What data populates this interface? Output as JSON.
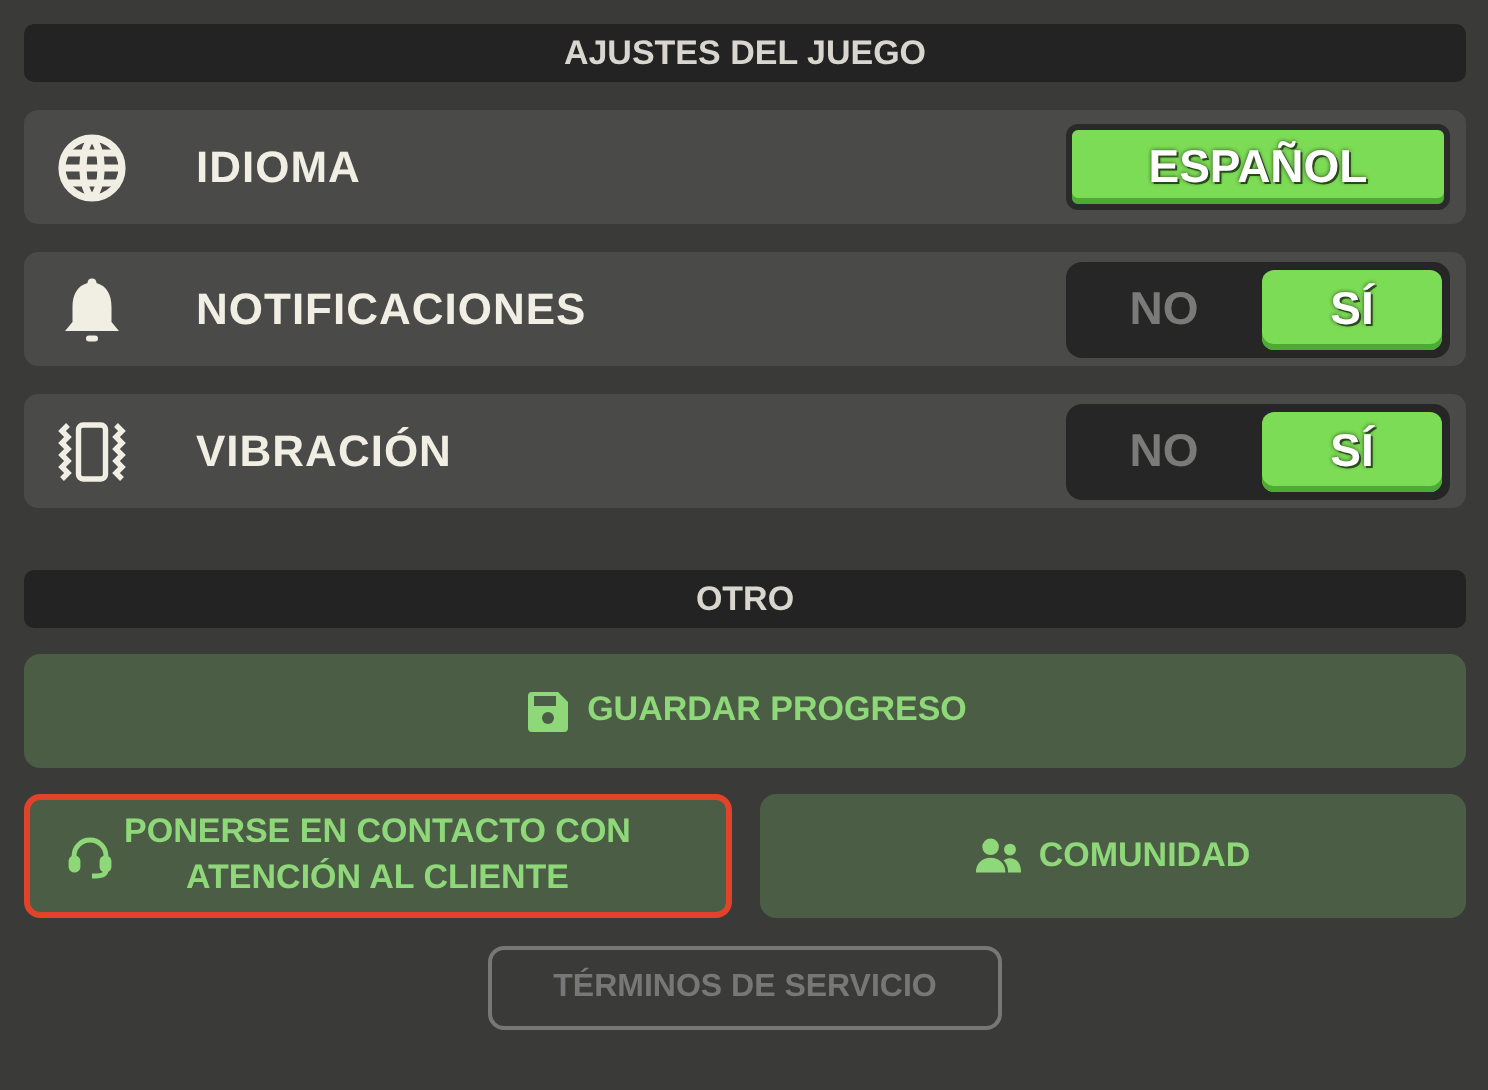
{
  "sections": [
    {
      "title": "AJUSTES DEL JUEGO",
      "settings": [
        {
          "kind": "choice",
          "label": "IDIOMA",
          "value": "ESPAÑOL"
        },
        {
          "kind": "toggle",
          "label": "NOTIFICACIONES",
          "options": [
            {
              "label": "NO",
              "selected": false
            },
            {
              "label": "SÍ",
              "selected": true
            }
          ]
        },
        {
          "kind": "toggle",
          "label": "VIBRACIÓN",
          "options": [
            {
              "label": "NO",
              "selected": false
            },
            {
              "label": "SÍ",
              "selected": true
            }
          ]
        }
      ]
    },
    {
      "title": "OTRO",
      "button_rows": [
        [
          {
            "label": "GUARDAR PROGRESO",
            "focused": false
          }
        ],
        [
          {
            "label": "PONERSE EN CONTACTO CON ATENCIÓN AL CLIENTE",
            "focused": true
          },
          {
            "label": "COMUNIDAD",
            "focused": false
          }
        ]
      ]
    }
  ],
  "footer_link": "TÉRMINOS DE SERVICIO"
}
